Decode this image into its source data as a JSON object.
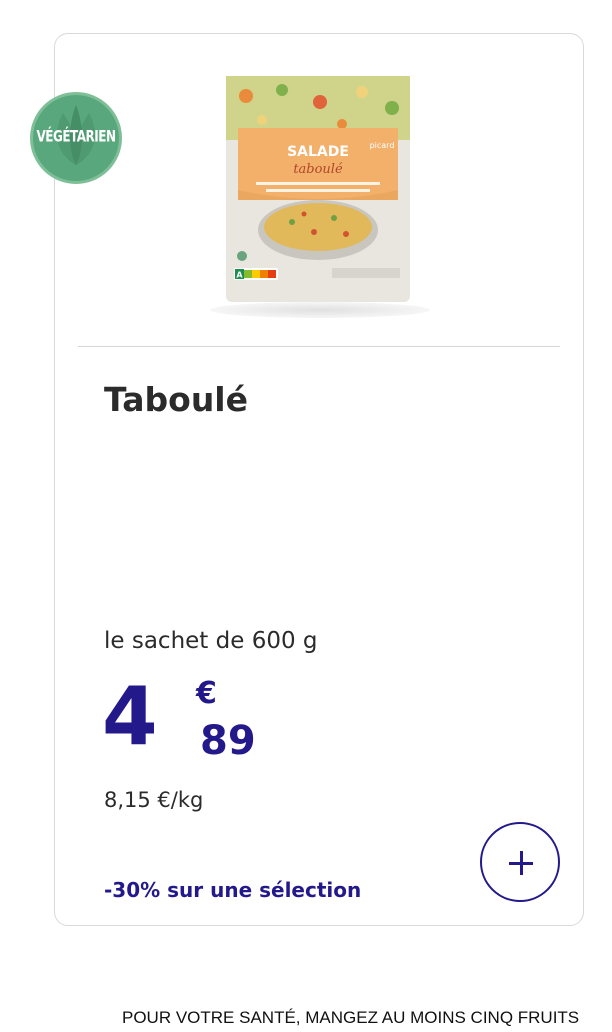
{
  "badge": {
    "label": "VÉGÉTARIEN",
    "color": "#59a77d"
  },
  "product": {
    "image_icon": "salad-package-icon",
    "package_brand": "SALADE",
    "package_name": "taboulé",
    "package_logo": "picard",
    "nutriscore": "A"
  },
  "product_title": "Taboulé",
  "quantity": "le sachet de 600 g",
  "price": {
    "integer": "4",
    "currency": "€",
    "decimals": "89",
    "color": "#23198a"
  },
  "unit_price": "8,15 €/kg",
  "promo": "-30% sur une sélection",
  "add_button": {
    "icon": "plus-icon"
  },
  "footer": {
    "text": "POUR VOTRE SANTÉ, MANGEZ AU MOINS CINQ FRUITS"
  }
}
